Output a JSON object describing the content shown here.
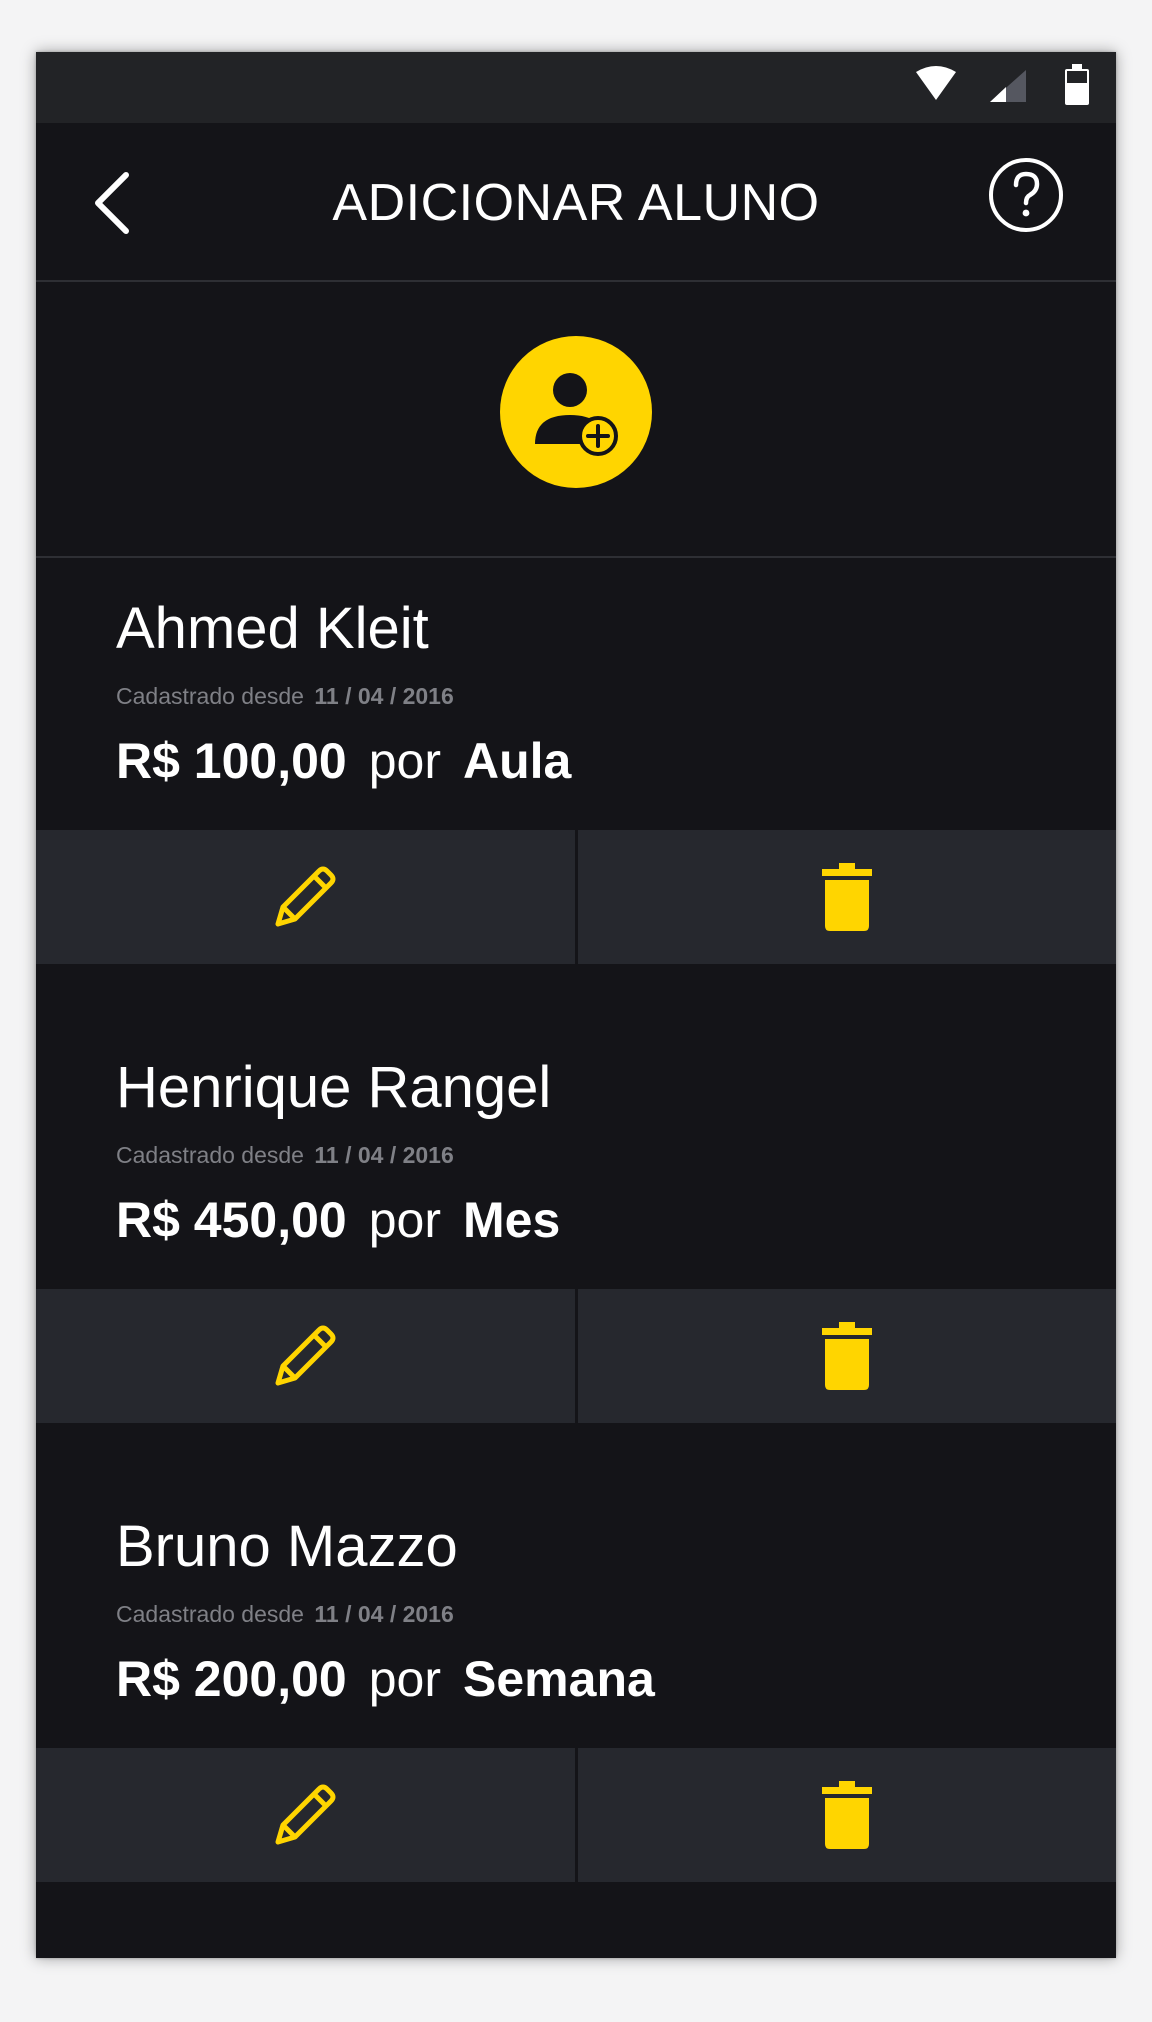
{
  "theme": {
    "accent": "#ffd500",
    "background": "#141418",
    "action_bar": "#26282e",
    "status_bar": "#222326"
  },
  "status_bar": {
    "icons": [
      "wifi-icon",
      "cellular-signal-icon",
      "battery-icon"
    ]
  },
  "header": {
    "title": "ADICIONAR ALUNO",
    "back_icon": "chevron-left-icon",
    "help_icon": "help-circle-icon"
  },
  "add_button": {
    "icon": "add-user-icon"
  },
  "students": [
    {
      "name": "Ahmed Kleit",
      "since_label": "Cadastrado desde",
      "since_date": "11 / 04 / 2016",
      "price": "R$ 100,00",
      "per": "por",
      "period": "Aula"
    },
    {
      "name": "Henrique Rangel",
      "since_label": "Cadastrado desde",
      "since_date": "11 / 04 / 2016",
      "price": "R$ 450,00",
      "per": "por",
      "period": "Mes"
    },
    {
      "name": "Bruno Mazzo",
      "since_label": "Cadastrado desde",
      "since_date": "11 / 04 / 2016",
      "price": "R$ 200,00",
      "per": "por",
      "period": "Semana"
    }
  ],
  "card_actions": {
    "edit_icon": "pencil-icon",
    "delete_icon": "trash-icon"
  }
}
